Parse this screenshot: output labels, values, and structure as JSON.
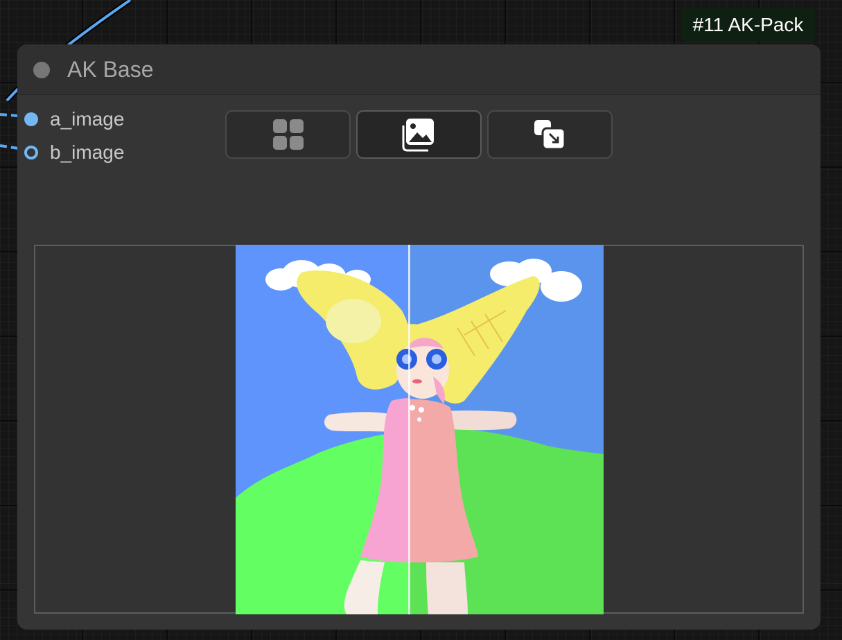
{
  "node": {
    "id_badge": "#11 AK-Pack",
    "title": "AK Base",
    "inputs": [
      {
        "label": "a_image",
        "state": "connected"
      },
      {
        "label": "b_image",
        "state": "connected"
      }
    ],
    "toolbar": [
      {
        "icon": "grid-icon",
        "active": false
      },
      {
        "icon": "image-icon",
        "active": true
      },
      {
        "icon": "swap-images-icon",
        "active": false
      }
    ]
  },
  "compare_viewer": {
    "mode": "split-compare",
    "split_position": 0.47
  },
  "colors": {
    "slot_blue": "#73b8f4",
    "link_blue": "#5aa8f0"
  }
}
